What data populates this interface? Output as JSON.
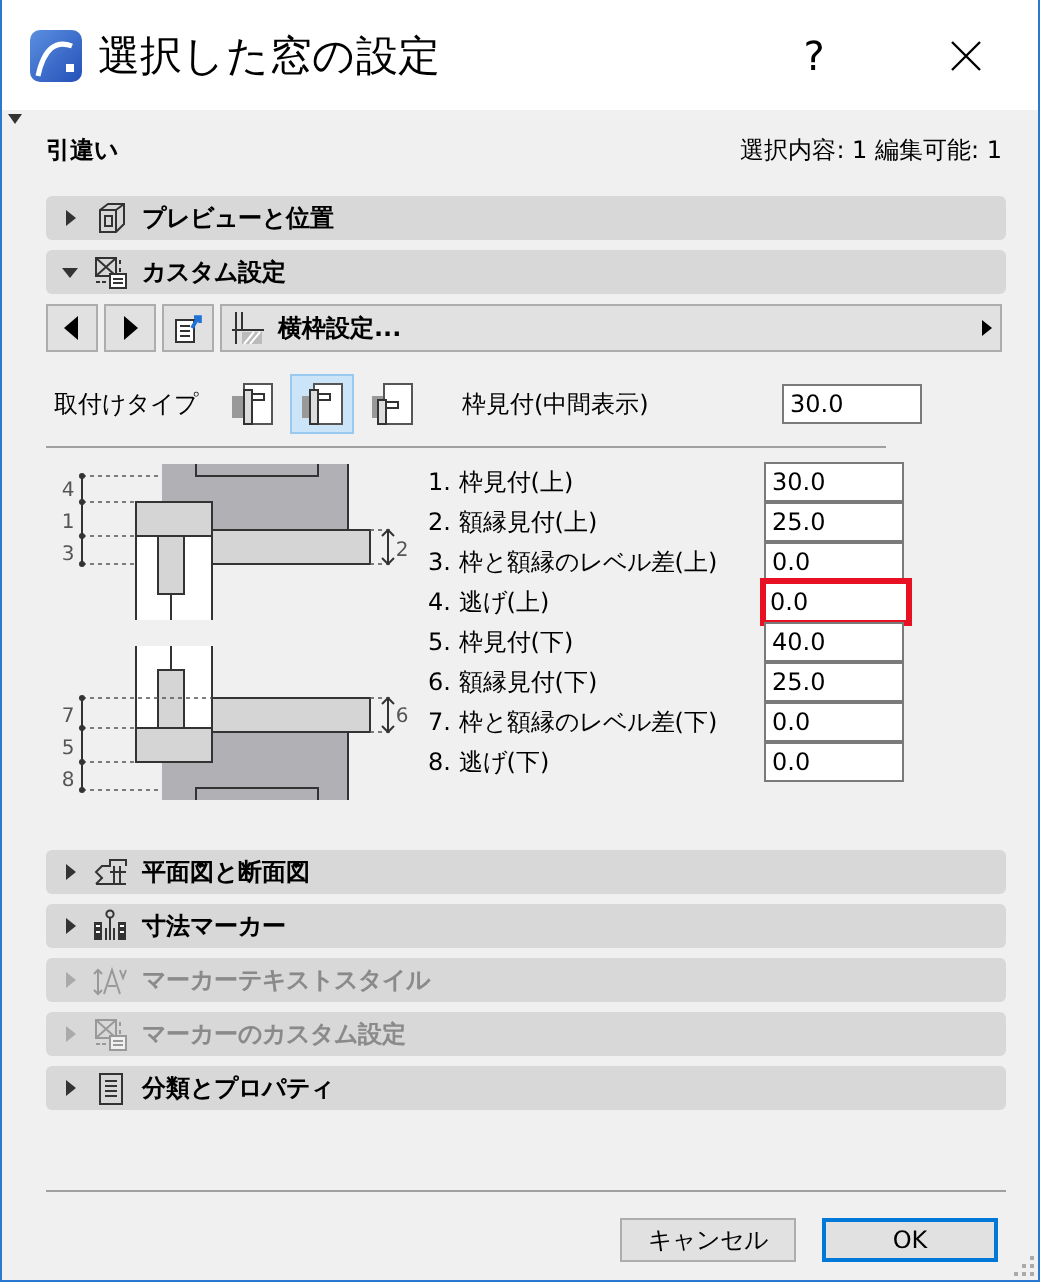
{
  "window": {
    "title": "選択した窓の設定",
    "help": "?"
  },
  "element_type": "引違い",
  "selection_info": "選択内容: 1 編集可能: 1",
  "sections": [
    {
      "label": "プレビューと位置",
      "expanded": false,
      "disabled": false
    },
    {
      "label": "カスタム設定",
      "expanded": true,
      "disabled": false
    },
    {
      "label": "平面図と断面図",
      "expanded": false,
      "disabled": false
    },
    {
      "label": "寸法マーカー",
      "expanded": false,
      "disabled": false
    },
    {
      "label": "マーカーテキストスタイル",
      "expanded": false,
      "disabled": true
    },
    {
      "label": "マーカーのカスタム設定",
      "expanded": false,
      "disabled": true
    },
    {
      "label": "分類とプロパティ",
      "expanded": false,
      "disabled": false
    }
  ],
  "custom_panel": {
    "page_title": "横枠設定...",
    "mount_type": {
      "label": "取付けタイプ",
      "options": [
        {
          "selected": false
        },
        {
          "selected": true
        },
        {
          "selected": false
        }
      ]
    },
    "middle_frame": {
      "label": "枠見付(中間表示)",
      "value": "30.0"
    },
    "diagram_labels": [
      "4",
      "1",
      "3",
      "2",
      "7",
      "6",
      "5",
      "8"
    ],
    "parameters": [
      {
        "label": "1. 枠見付(上)",
        "value": "30.0",
        "highlighted": false
      },
      {
        "label": "2. 額縁見付(上)",
        "value": "25.0",
        "highlighted": false
      },
      {
        "label": "3. 枠と額縁のレベル差(上)",
        "value": "0.0",
        "highlighted": false
      },
      {
        "label": "4. 逃げ(上)",
        "value": "0.0",
        "highlighted": true
      },
      {
        "label": "5. 枠見付(下)",
        "value": "40.0",
        "highlighted": false
      },
      {
        "label": "6. 額縁見付(下)",
        "value": "25.0",
        "highlighted": false
      },
      {
        "label": "7. 枠と額縁のレベル差(下)",
        "value": "0.0",
        "highlighted": false
      },
      {
        "label": "8. 逃げ(下)",
        "value": "0.0",
        "highlighted": false
      }
    ]
  },
  "buttons": [
    {
      "label": "キャンセル",
      "default": false
    },
    {
      "label": "OK",
      "default": true
    }
  ]
}
